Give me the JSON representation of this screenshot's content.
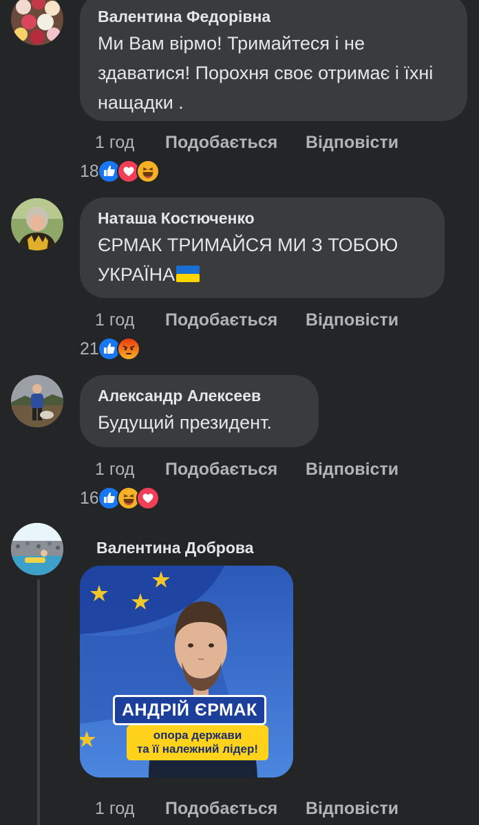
{
  "comments": [
    {
      "author": "Валентина Федорівна",
      "text": "Ми Вам вірмо! Тримайтеся і не здаватися! Порохня своє отримає і їхні нащадки .",
      "time": "1 год",
      "like_label": "Подобається",
      "reply_label": "Відповісти",
      "reaction_count": "18",
      "reactions": [
        "like-icon",
        "love-icon",
        "haha-icon"
      ]
    },
    {
      "author": "Наташа Костюченко",
      "text": "ЄРМАК ТРИМАЙСЯ МИ З ТОБОЮ УКРАЇНА",
      "text_emoji": "ukraine-flag-icon",
      "time": "1 год",
      "like_label": "Подобається",
      "reply_label": "Відповісти",
      "reaction_count": "21",
      "reactions": [
        "like-icon",
        "angry-icon"
      ]
    },
    {
      "author": "Александр Алексеев",
      "text": "Будущий президент.",
      "time": "1 год",
      "like_label": "Подобається",
      "reply_label": "Відповісти",
      "reaction_count": "16",
      "reactions": [
        "like-icon",
        "haha-icon",
        "love-icon"
      ]
    },
    {
      "author": "Валентина Доброва",
      "image": {
        "title": "АНДРІЙ ЄРМАК",
        "subtitle_line1": "опора держави",
        "subtitle_line2": "та її належний лідер!"
      },
      "time": "1 год",
      "like_label": "Подобається",
      "reply_label": "Відповісти"
    }
  ],
  "colors": {
    "background": "#242526",
    "bubble": "#3a3b3c",
    "text": "#e4e6eb",
    "meta_text": "#b0b3b8",
    "like_blue": "#1877f2",
    "love_red": "#f33e58",
    "haha_yellow": "#f7b125",
    "angry_orange": "#e9710f"
  }
}
